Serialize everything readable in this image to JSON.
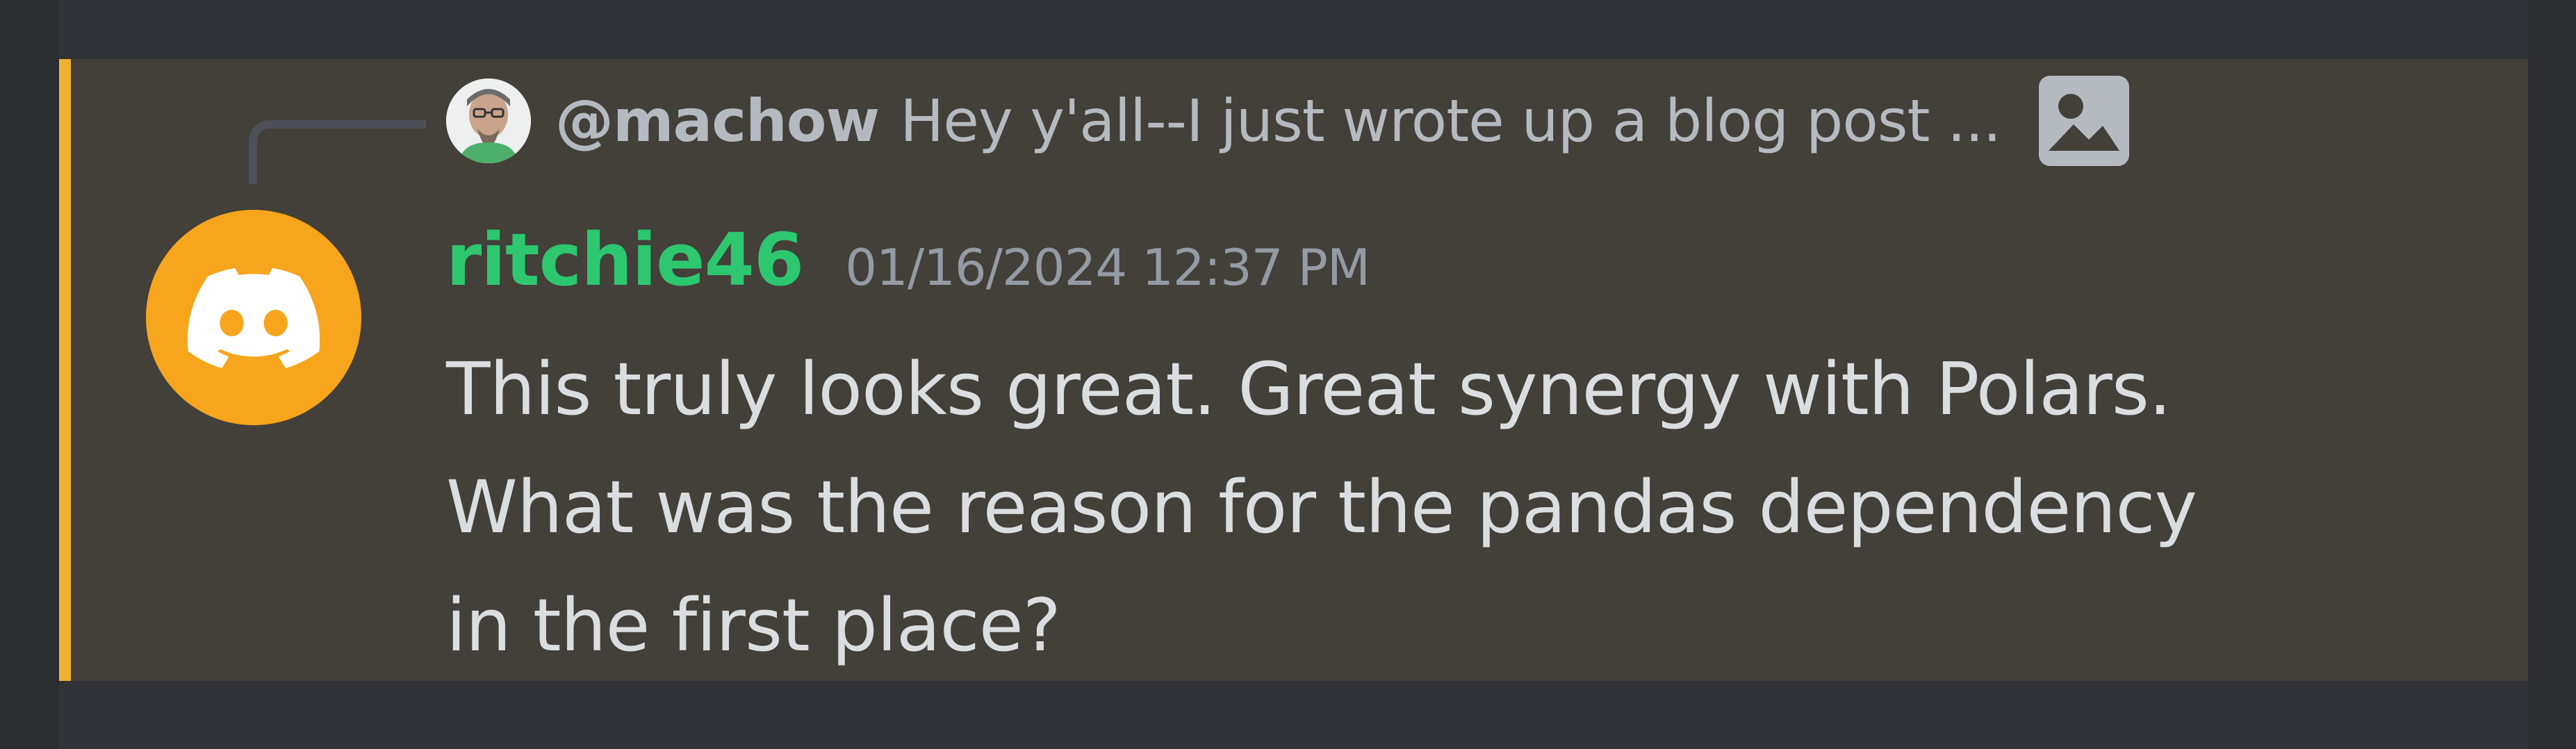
{
  "reply": {
    "author": "@machow",
    "preview": "Hey y'all--I just wrote up a blog post ...",
    "avatar_icon": "user-avatar",
    "attachment_icon": "image-icon"
  },
  "message": {
    "username": "ritchie46",
    "timestamp": "01/16/2024 12:37 PM",
    "avatar_icon": "discord-logo-icon",
    "avatar_color": "#f6a51d",
    "username_color": "#2dc770",
    "mention_highlight_color": "#f0b132",
    "content_lines": [
      "This truly looks great. Great synergy with Polars.",
      "What was the reason for the pandas dependency",
      "in the first place?"
    ]
  }
}
